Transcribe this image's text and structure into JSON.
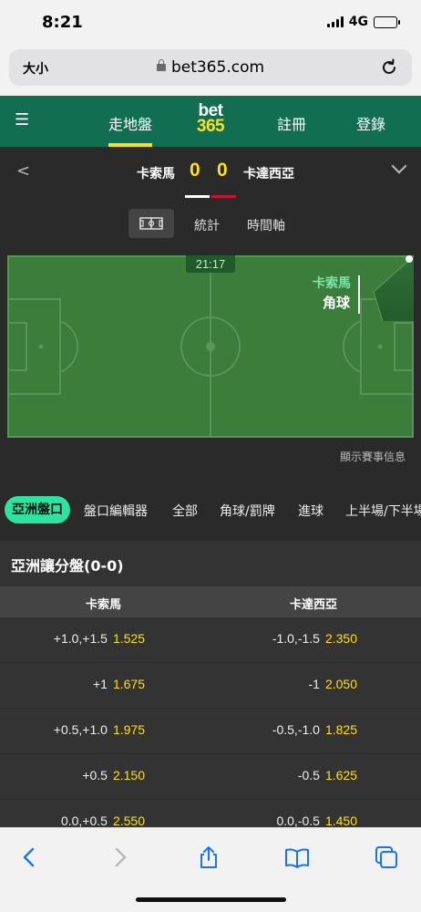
{
  "status_bar": {
    "time": "8:21",
    "network": "4G"
  },
  "browser": {
    "text_size_label": "大小",
    "url": "bet365.com"
  },
  "header": {
    "live_label": "走地盤",
    "logo_top": "bet",
    "logo_bottom": "365",
    "register_label": "註冊",
    "login_label": "登錄",
    "brand_green": "#126e51",
    "accent_yellow": "#ffdf1b"
  },
  "match": {
    "home_team": "卡索馬",
    "away_team": "卡達西亞",
    "home_score": "0",
    "away_score": "0",
    "home_kit_color": "#ffffff",
    "away_kit_color": "#c8143c"
  },
  "view_tabs": {
    "pitch_icon": "pitch-icon",
    "stats_label": "統計",
    "timeline_label": "時間軸"
  },
  "pitch": {
    "clock": "21:17",
    "event_team": "卡索馬",
    "event_type": "角球"
  },
  "match_info_link": "顯示賽事信息",
  "market_tabs": [
    "亞洲盤口",
    "盤口編輯器",
    "全部",
    "角球/罰牌",
    "進球",
    "上半場/下半場"
  ],
  "market": {
    "title": "亞洲讓分盤(0-0)",
    "columns": [
      "卡索馬",
      "卡達西亞"
    ],
    "rows": [
      {
        "home_line": "+1.0,+1.5",
        "home_odds": "1.525",
        "away_line": "-1.0,-1.5",
        "away_odds": "2.350"
      },
      {
        "home_line": "+1",
        "home_odds": "1.675",
        "away_line": "-1",
        "away_odds": "2.050"
      },
      {
        "home_line": "+0.5,+1.0",
        "home_odds": "1.975",
        "away_line": "-0.5,-1.0",
        "away_odds": "1.825"
      },
      {
        "home_line": "+0.5",
        "home_odds": "2.150",
        "away_line": "-0.5",
        "away_odds": "1.625"
      },
      {
        "home_line": "0.0,+0.5",
        "home_odds": "2.550",
        "away_line": "0.0,-0.5",
        "away_odds": "1.450"
      }
    ]
  },
  "toolbar_icons": [
    "back-icon",
    "forward-icon",
    "share-icon",
    "bookmarks-icon",
    "tabs-icon"
  ]
}
